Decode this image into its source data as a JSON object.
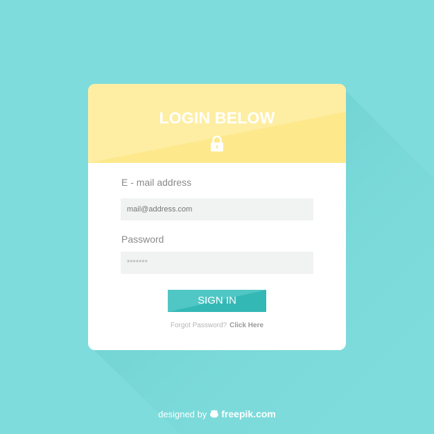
{
  "colors": {
    "background": "#7fdcdc",
    "header": "#fde98c",
    "button": "#34b8b6",
    "card": "#ffffff"
  },
  "login_card": {
    "title": "LOGIN BELOW",
    "header_icon": "lock-icon",
    "email": {
      "label": "E - mail address",
      "placeholder": "mail@address.com"
    },
    "password": {
      "label": "Password",
      "value": "*******"
    },
    "submit_label": "SIGN IN",
    "forgot_text": "Forgot Password?",
    "forgot_link": "Click Here"
  },
  "credit": {
    "prefix": "designed by",
    "brand": "freepik.com",
    "icon": "freepik-logo-icon"
  }
}
